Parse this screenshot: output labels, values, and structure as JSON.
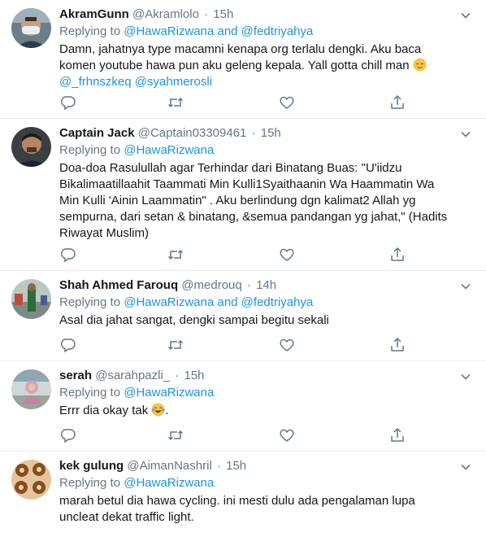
{
  "tweets": [
    {
      "name": "AkramGunn",
      "handle": "@Akramlolo",
      "dot": "·",
      "time": "15h",
      "replying_prefix": "Replying to",
      "replying_to": "@HawaRizwana and @fedtriyahya",
      "text_1": "Damn, jahatnya type macamni kenapa org terlalu dengki. Aku baca komen youtube hawa pun aku geleng kepala. Yall gotta chill man",
      "emoji": "relieved-face",
      "mention_1": "@_frhnszkeq",
      "mention_2": "@syahmerosli"
    },
    {
      "name": "Captain Jack",
      "handle": "@Captain03309461",
      "dot": "·",
      "time": "15h",
      "replying_prefix": "Replying to",
      "replying_to": "@HawaRizwana",
      "text": "Doa-doa Rasulullah agar Terhindar dari Binatang Buas: \"U'iidzu Bikalimaatillaahit Taammati Min Kulli1Syaithaanin Wa Haammatin Wa Min Kulli 'Ainin Laammatin\" . Aku berlindung dgn kalimat2 Allah yg sempurna, dari setan & binatang, &semua pandangan yg jahat,\" (Hadits Riwayat Muslim)"
    },
    {
      "name": "Shah Ahmed Farouq",
      "handle": "@medrouq",
      "dot": "·",
      "time": "14h",
      "replying_prefix": "Replying to",
      "replying_to": "@HawaRizwana and @fedtriyahya",
      "text": "Asal dia jahat sangat, dengki sampai begitu sekali"
    },
    {
      "name": "serah",
      "handle": "@sarahpazli_",
      "dot": "·",
      "time": "15h",
      "replying_prefix": "Replying to",
      "replying_to": "@HawaRizwana",
      "text": "Errr dia okay tak",
      "emoji": "tears-of-joy-face",
      "text_end": "."
    },
    {
      "name": "kek gulung",
      "handle": "@AimanNashril",
      "dot": "·",
      "time": "15h",
      "replying_prefix": "Replying to",
      "replying_to": "@HawaRizwana",
      "text": "marah betul dia hawa cycling. ini mesti dulu ada pengalaman lupa uncleat dekat traffic light."
    }
  ],
  "actions": [
    "reply-icon",
    "retweet-icon",
    "like-icon",
    "share-icon"
  ],
  "colors": {
    "link": "#1b95e0",
    "muted": "#657786",
    "text": "#14171a",
    "divider": "#e6ecf0"
  }
}
